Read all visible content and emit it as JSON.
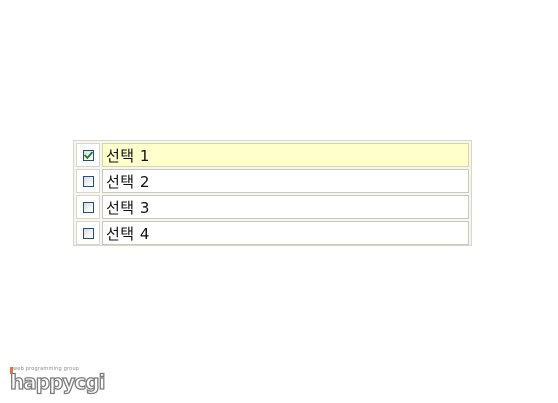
{
  "checklist": {
    "items": [
      {
        "label": "선택 1",
        "checked": true
      },
      {
        "label": "선택 2",
        "checked": false
      },
      {
        "label": "선택 3",
        "checked": false
      },
      {
        "label": "선택 4",
        "checked": false
      }
    ]
  },
  "logo": {
    "tagline": "web programming group",
    "wordmark": "happycgi"
  },
  "colors": {
    "selected_row": "#ffffcc",
    "checkmark": "#1a7f2a",
    "checkbox_border": "#1f4d8f",
    "panel_border": "#d9d6c4",
    "logo_accent": "#e07a3a"
  },
  "icons": {
    "checkbox_checked": "checkbox-checked-icon",
    "checkbox_unchecked": "checkbox-unchecked-icon"
  }
}
